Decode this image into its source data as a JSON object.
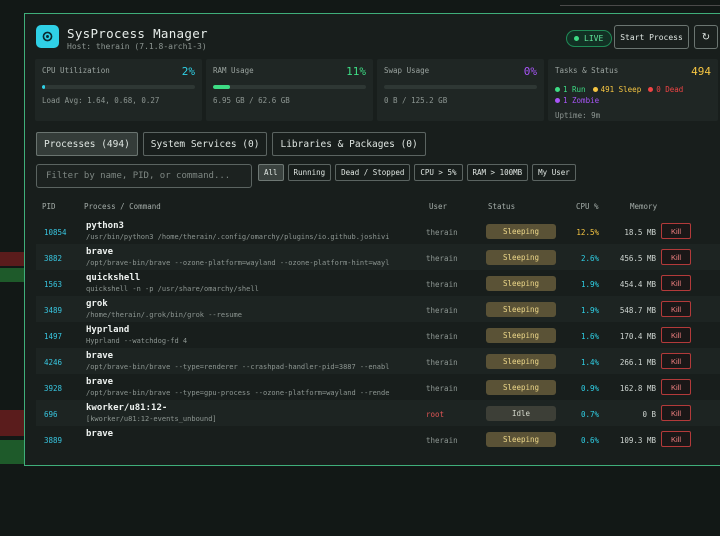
{
  "app": {
    "title": "SysProcess Manager",
    "host": "Host: therain (7.1.8-arch1-3)",
    "live_label": "LIVE",
    "start_label": "Start Process",
    "refresh_icon": "refresh-icon",
    "accent": "#2fd0e6"
  },
  "stats": {
    "cpu": {
      "label": "CPU Utilization",
      "value": "2%",
      "percent": 2,
      "sub": "Load Avg: 1.64, 0.68, 0.27",
      "color": "#2fd0e6"
    },
    "ram": {
      "label": "RAM Usage",
      "value": "11%",
      "percent": 11,
      "sub": "6.95 GB / 62.6 GB",
      "color": "#3ddc84"
    },
    "swap": {
      "label": "Swap Usage",
      "value": "0%",
      "percent": 0,
      "sub": "0 B / 125.2 GB",
      "color": "#a855f7"
    },
    "tasks": {
      "label": "Tasks & Status",
      "value": "494",
      "run": "1 Run",
      "sleep": "491 Sleep",
      "dead": "0 Dead",
      "zombie": "1 Zombie",
      "uptime": "Uptime: 9m"
    }
  },
  "tabs": [
    {
      "label": "Processes (494)"
    },
    {
      "label": "System Services (0)"
    },
    {
      "label": "Libraries & Packages (0)"
    }
  ],
  "search": {
    "placeholder": "Filter by name, PID, or command..."
  },
  "filters": [
    "All",
    "Running",
    "Dead / Stopped",
    "CPU > 5%",
    "RAM > 100MB",
    "My User"
  ],
  "columns": {
    "pid": "PID",
    "process": "Process / Command",
    "user": "User",
    "status": "Status",
    "cpu": "CPU %",
    "memory": "Memory"
  },
  "kill_label": "Kill",
  "processes": [
    {
      "pid": "10854",
      "name": "python3",
      "cmd": "/usr/bin/python3 /home/therain/.config/omarchy/plugins/io.github.joshivi",
      "user": "therain",
      "status": "Sleeping",
      "cpu": "12.5%",
      "mem": "18.5 MB"
    },
    {
      "pid": "3882",
      "name": "brave",
      "cmd": "/opt/brave-bin/brave --ozone-platform=wayland --ozone-platform-hint=wayl",
      "user": "therain",
      "status": "Sleeping",
      "cpu": "2.6%",
      "mem": "456.5 MB"
    },
    {
      "pid": "1563",
      "name": "quickshell",
      "cmd": "quickshell -n -p /usr/share/omarchy/shell",
      "user": "therain",
      "status": "Sleeping",
      "cpu": "1.9%",
      "mem": "454.4 MB"
    },
    {
      "pid": "3489",
      "name": "grok",
      "cmd": "/home/therain/.grok/bin/grok --resume",
      "user": "therain",
      "status": "Sleeping",
      "cpu": "1.9%",
      "mem": "548.7 MB"
    },
    {
      "pid": "1497",
      "name": "Hyprland",
      "cmd": "Hyprland --watchdog-fd 4",
      "user": "therain",
      "status": "Sleeping",
      "cpu": "1.6%",
      "mem": "170.4 MB"
    },
    {
      "pid": "4246",
      "name": "brave",
      "cmd": "/opt/brave-bin/brave --type=renderer --crashpad-handler-pid=3887 --enabl",
      "user": "therain",
      "status": "Sleeping",
      "cpu": "1.4%",
      "mem": "266.1 MB"
    },
    {
      "pid": "3928",
      "name": "brave",
      "cmd": "/opt/brave-bin/brave --type=gpu-process --ozone-platform=wayland --rende",
      "user": "therain",
      "status": "Sleeping",
      "cpu": "0.9%",
      "mem": "162.8 MB"
    },
    {
      "pid": "696",
      "name": "kworker/u81:12-",
      "cmd": "[kworker/u81:12-events_unbound]",
      "user": "root",
      "status": "Idle",
      "cpu": "0.7%",
      "mem": "0 B"
    },
    {
      "pid": "3889",
      "name": "brave",
      "cmd": "",
      "user": "therain",
      "status": "Sleeping",
      "cpu": "0.6%",
      "mem": "109.3 MB"
    }
  ]
}
